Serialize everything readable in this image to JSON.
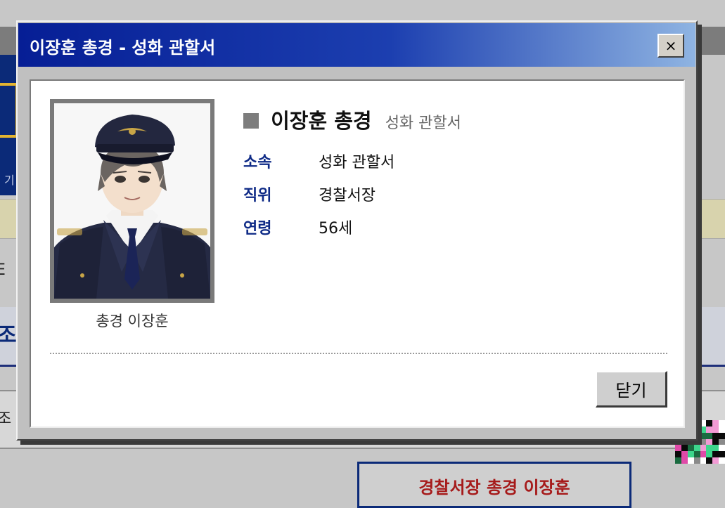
{
  "dialog": {
    "title": "이장훈 총경 - 성화 관할서",
    "close_label": "×",
    "close_icon": "close-icon",
    "portrait_caption": "총경 이장훈",
    "name": "이장훈 총경",
    "station": "성화 관할서",
    "info": [
      {
        "label": "소속",
        "value": "성화 관할서"
      },
      {
        "label": "직위",
        "value": "경찰서장"
      },
      {
        "label": "연령",
        "value": "56세"
      }
    ],
    "ok_label": "닫기"
  },
  "background": {
    "partial_row_1": "E",
    "partial_band": "조",
    "partial_row_2": "조",
    "bottom_box": "경찰서장 총경 이장훈"
  },
  "colors": {
    "titlebar_start": "#061e95",
    "titlebar_end": "#8fb4e2",
    "label_blue": "#0e2a86",
    "accent_red": "#a61a1a"
  }
}
